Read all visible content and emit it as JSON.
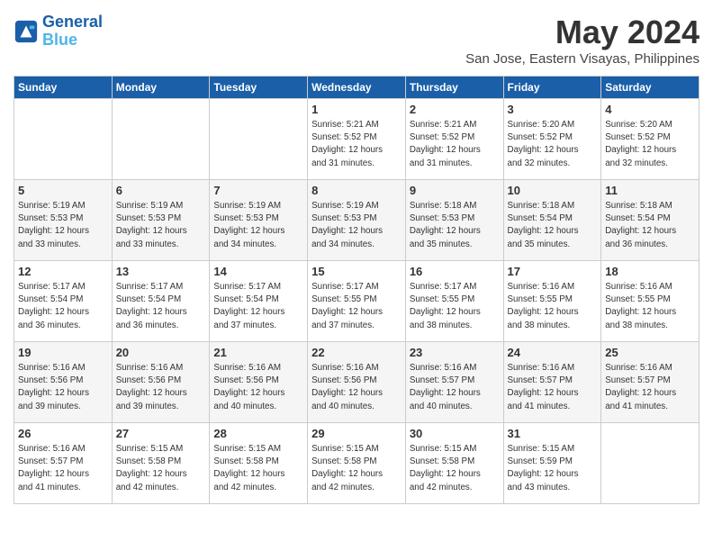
{
  "header": {
    "logo_line1": "General",
    "logo_line2": "Blue",
    "month": "May 2024",
    "location": "San Jose, Eastern Visayas, Philippines"
  },
  "weekdays": [
    "Sunday",
    "Monday",
    "Tuesday",
    "Wednesday",
    "Thursday",
    "Friday",
    "Saturday"
  ],
  "weeks": [
    [
      {
        "day": "",
        "info": ""
      },
      {
        "day": "",
        "info": ""
      },
      {
        "day": "",
        "info": ""
      },
      {
        "day": "1",
        "info": "Sunrise: 5:21 AM\nSunset: 5:52 PM\nDaylight: 12 hours\nand 31 minutes."
      },
      {
        "day": "2",
        "info": "Sunrise: 5:21 AM\nSunset: 5:52 PM\nDaylight: 12 hours\nand 31 minutes."
      },
      {
        "day": "3",
        "info": "Sunrise: 5:20 AM\nSunset: 5:52 PM\nDaylight: 12 hours\nand 32 minutes."
      },
      {
        "day": "4",
        "info": "Sunrise: 5:20 AM\nSunset: 5:52 PM\nDaylight: 12 hours\nand 32 minutes."
      }
    ],
    [
      {
        "day": "5",
        "info": "Sunrise: 5:19 AM\nSunset: 5:53 PM\nDaylight: 12 hours\nand 33 minutes."
      },
      {
        "day": "6",
        "info": "Sunrise: 5:19 AM\nSunset: 5:53 PM\nDaylight: 12 hours\nand 33 minutes."
      },
      {
        "day": "7",
        "info": "Sunrise: 5:19 AM\nSunset: 5:53 PM\nDaylight: 12 hours\nand 34 minutes."
      },
      {
        "day": "8",
        "info": "Sunrise: 5:19 AM\nSunset: 5:53 PM\nDaylight: 12 hours\nand 34 minutes."
      },
      {
        "day": "9",
        "info": "Sunrise: 5:18 AM\nSunset: 5:53 PM\nDaylight: 12 hours\nand 35 minutes."
      },
      {
        "day": "10",
        "info": "Sunrise: 5:18 AM\nSunset: 5:54 PM\nDaylight: 12 hours\nand 35 minutes."
      },
      {
        "day": "11",
        "info": "Sunrise: 5:18 AM\nSunset: 5:54 PM\nDaylight: 12 hours\nand 36 minutes."
      }
    ],
    [
      {
        "day": "12",
        "info": "Sunrise: 5:17 AM\nSunset: 5:54 PM\nDaylight: 12 hours\nand 36 minutes."
      },
      {
        "day": "13",
        "info": "Sunrise: 5:17 AM\nSunset: 5:54 PM\nDaylight: 12 hours\nand 36 minutes."
      },
      {
        "day": "14",
        "info": "Sunrise: 5:17 AM\nSunset: 5:54 PM\nDaylight: 12 hours\nand 37 minutes."
      },
      {
        "day": "15",
        "info": "Sunrise: 5:17 AM\nSunset: 5:55 PM\nDaylight: 12 hours\nand 37 minutes."
      },
      {
        "day": "16",
        "info": "Sunrise: 5:17 AM\nSunset: 5:55 PM\nDaylight: 12 hours\nand 38 minutes."
      },
      {
        "day": "17",
        "info": "Sunrise: 5:16 AM\nSunset: 5:55 PM\nDaylight: 12 hours\nand 38 minutes."
      },
      {
        "day": "18",
        "info": "Sunrise: 5:16 AM\nSunset: 5:55 PM\nDaylight: 12 hours\nand 38 minutes."
      }
    ],
    [
      {
        "day": "19",
        "info": "Sunrise: 5:16 AM\nSunset: 5:56 PM\nDaylight: 12 hours\nand 39 minutes."
      },
      {
        "day": "20",
        "info": "Sunrise: 5:16 AM\nSunset: 5:56 PM\nDaylight: 12 hours\nand 39 minutes."
      },
      {
        "day": "21",
        "info": "Sunrise: 5:16 AM\nSunset: 5:56 PM\nDaylight: 12 hours\nand 40 minutes."
      },
      {
        "day": "22",
        "info": "Sunrise: 5:16 AM\nSunset: 5:56 PM\nDaylight: 12 hours\nand 40 minutes."
      },
      {
        "day": "23",
        "info": "Sunrise: 5:16 AM\nSunset: 5:57 PM\nDaylight: 12 hours\nand 40 minutes."
      },
      {
        "day": "24",
        "info": "Sunrise: 5:16 AM\nSunset: 5:57 PM\nDaylight: 12 hours\nand 41 minutes."
      },
      {
        "day": "25",
        "info": "Sunrise: 5:16 AM\nSunset: 5:57 PM\nDaylight: 12 hours\nand 41 minutes."
      }
    ],
    [
      {
        "day": "26",
        "info": "Sunrise: 5:16 AM\nSunset: 5:57 PM\nDaylight: 12 hours\nand 41 minutes."
      },
      {
        "day": "27",
        "info": "Sunrise: 5:15 AM\nSunset: 5:58 PM\nDaylight: 12 hours\nand 42 minutes."
      },
      {
        "day": "28",
        "info": "Sunrise: 5:15 AM\nSunset: 5:58 PM\nDaylight: 12 hours\nand 42 minutes."
      },
      {
        "day": "29",
        "info": "Sunrise: 5:15 AM\nSunset: 5:58 PM\nDaylight: 12 hours\nand 42 minutes."
      },
      {
        "day": "30",
        "info": "Sunrise: 5:15 AM\nSunset: 5:58 PM\nDaylight: 12 hours\nand 42 minutes."
      },
      {
        "day": "31",
        "info": "Sunrise: 5:15 AM\nSunset: 5:59 PM\nDaylight: 12 hours\nand 43 minutes."
      },
      {
        "day": "",
        "info": ""
      }
    ]
  ]
}
